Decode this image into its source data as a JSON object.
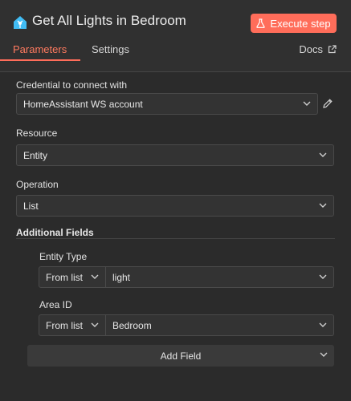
{
  "header": {
    "node_icon": "home-assistant-icon",
    "title": "Get All Lights in Bedroom",
    "execute_label": "Execute step",
    "execute_icon": "flask-icon",
    "accent_color": "#ff6d5a"
  },
  "tabs": {
    "parameters": "Parameters",
    "settings": "Settings",
    "docs": "Docs",
    "docs_icon": "external-link-icon",
    "active": "Parameters"
  },
  "form": {
    "credential": {
      "label": "Credential to connect with",
      "value": "HomeAssistant WS account",
      "edit_icon": "pencil-icon"
    },
    "resource": {
      "label": "Resource",
      "value": "Entity"
    },
    "operation": {
      "label": "Operation",
      "value": "List"
    },
    "additional_fields": {
      "title": "Additional Fields",
      "entity_type": {
        "label": "Entity Type",
        "mode": "From list",
        "value": "light"
      },
      "area_id": {
        "label": "Area ID",
        "mode": "From list",
        "value": "Bedroom"
      },
      "add_field_label": "Add Field"
    }
  }
}
